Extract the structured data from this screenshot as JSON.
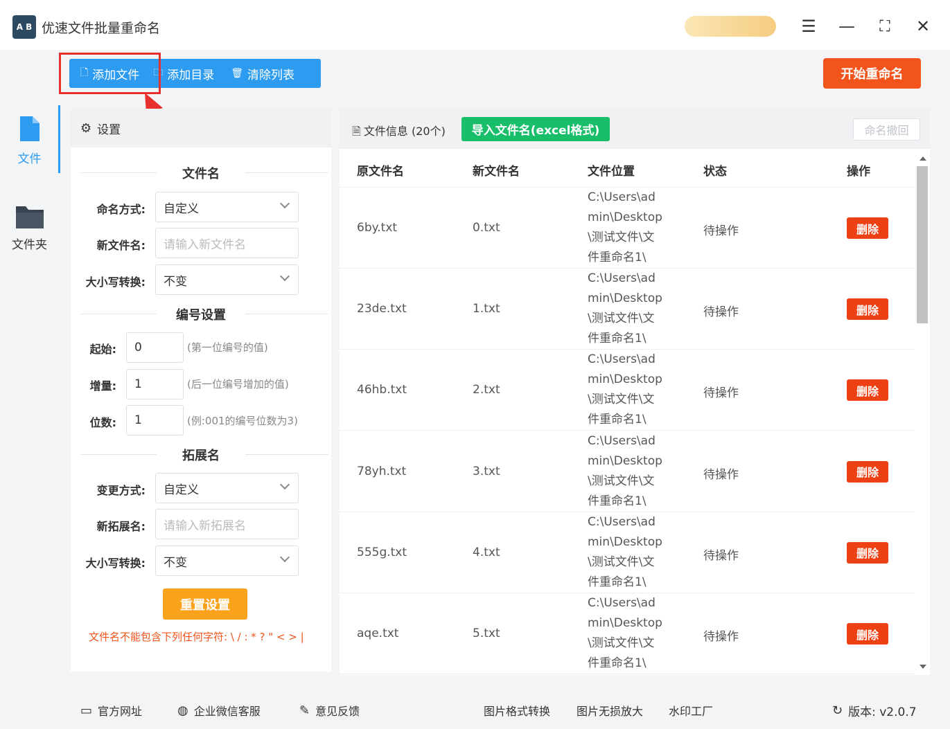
{
  "app": {
    "title": "优速文件批量重命名",
    "logo_text": "A B",
    "icons": {
      "menu": "☰",
      "minimize": "—",
      "maximize": "⛶",
      "close": "✕"
    }
  },
  "toolbar": {
    "add_file": "添加文件",
    "add_dir": "添加目录",
    "clear_list": "清除列表",
    "start_rename": "开始重命名"
  },
  "nav": {
    "file_label": "文件",
    "folder_label": "文件夹"
  },
  "settings": {
    "header": "设置",
    "filename_section": "文件名",
    "naming_mode_label": "命名方式:",
    "naming_mode_value": "自定义",
    "new_name_label": "新文件名:",
    "new_name_placeholder": "请输入新文件名",
    "case_label": "大小写转换:",
    "case_value": "不变",
    "numbering_section": "编号设置",
    "start_label": "起始:",
    "start_value": "0",
    "start_hint": "(第一位编号的值)",
    "step_label": "增量:",
    "step_value": "1",
    "step_hint": "(后一位编号增加的值)",
    "digits_label": "位数:",
    "digits_value": "1",
    "digits_hint": "(例:001的编号位数为3)",
    "ext_section": "拓展名",
    "change_mode_label": "变更方式:",
    "change_mode_value": "自定义",
    "new_ext_label": "新拓展名:",
    "new_ext_placeholder": "请输入新拓展名",
    "ext_case_label": "大小写转换:",
    "ext_case_value": "不变",
    "reset_button": "重置设置",
    "warning": "文件名不能包含下列任何字符: \\ / : * ? \" < > |"
  },
  "fileinfo": {
    "title": "文件信息 (20个)",
    "import_button": "导入文件名(excel格式)",
    "undo_button": "命名撤回",
    "columns": [
      "原文件名",
      "新文件名",
      "文件位置",
      "状态",
      "操作"
    ],
    "rows": [
      {
        "orig": "6by.txt",
        "new": "0.txt",
        "path": [
          "C:\\Users\\ad",
          "min\\Desktop",
          "\\测试文件\\文",
          "件重命名1\\"
        ],
        "status": "待操作",
        "action": "删除"
      },
      {
        "orig": "23de.txt",
        "new": "1.txt",
        "path": [
          "C:\\Users\\ad",
          "min\\Desktop",
          "\\测试文件\\文",
          "件重命名1\\"
        ],
        "status": "待操作",
        "action": "删除"
      },
      {
        "orig": "46hb.txt",
        "new": "2.txt",
        "path": [
          "C:\\Users\\ad",
          "min\\Desktop",
          "\\测试文件\\文",
          "件重命名1\\"
        ],
        "status": "待操作",
        "action": "删除"
      },
      {
        "orig": "78yh.txt",
        "new": "3.txt",
        "path": [
          "C:\\Users\\ad",
          "min\\Desktop",
          "\\测试文件\\文",
          "件重命名1\\"
        ],
        "status": "待操作",
        "action": "删除"
      },
      {
        "orig": "555g.txt",
        "new": "4.txt",
        "path": [
          "C:\\Users\\ad",
          "min\\Desktop",
          "\\测试文件\\文",
          "件重命名1\\"
        ],
        "status": "待操作",
        "action": "删除"
      },
      {
        "orig": "aqe.txt",
        "new": "5.txt",
        "path": [
          "C:\\Users\\ad",
          "min\\Desktop",
          "\\测试文件\\文",
          "件重命名1\\"
        ],
        "status": "待操作",
        "action": "删除"
      }
    ]
  },
  "footer": {
    "website": "官方网址",
    "wechat": "企业微信客服",
    "feedback": "意见反馈",
    "img_convert": "图片格式转换",
    "img_enlarge": "图片无损放大",
    "watermark": "水印工厂",
    "version": "版本: v2.0.7"
  },
  "colors": {
    "primary_blue": "#2d9cf0",
    "start_orange": "#f2541b",
    "import_green": "#19be6b",
    "reset_orange": "#fba21c",
    "delete_red": "#ed4014",
    "highlight_red": "#e8312e"
  }
}
